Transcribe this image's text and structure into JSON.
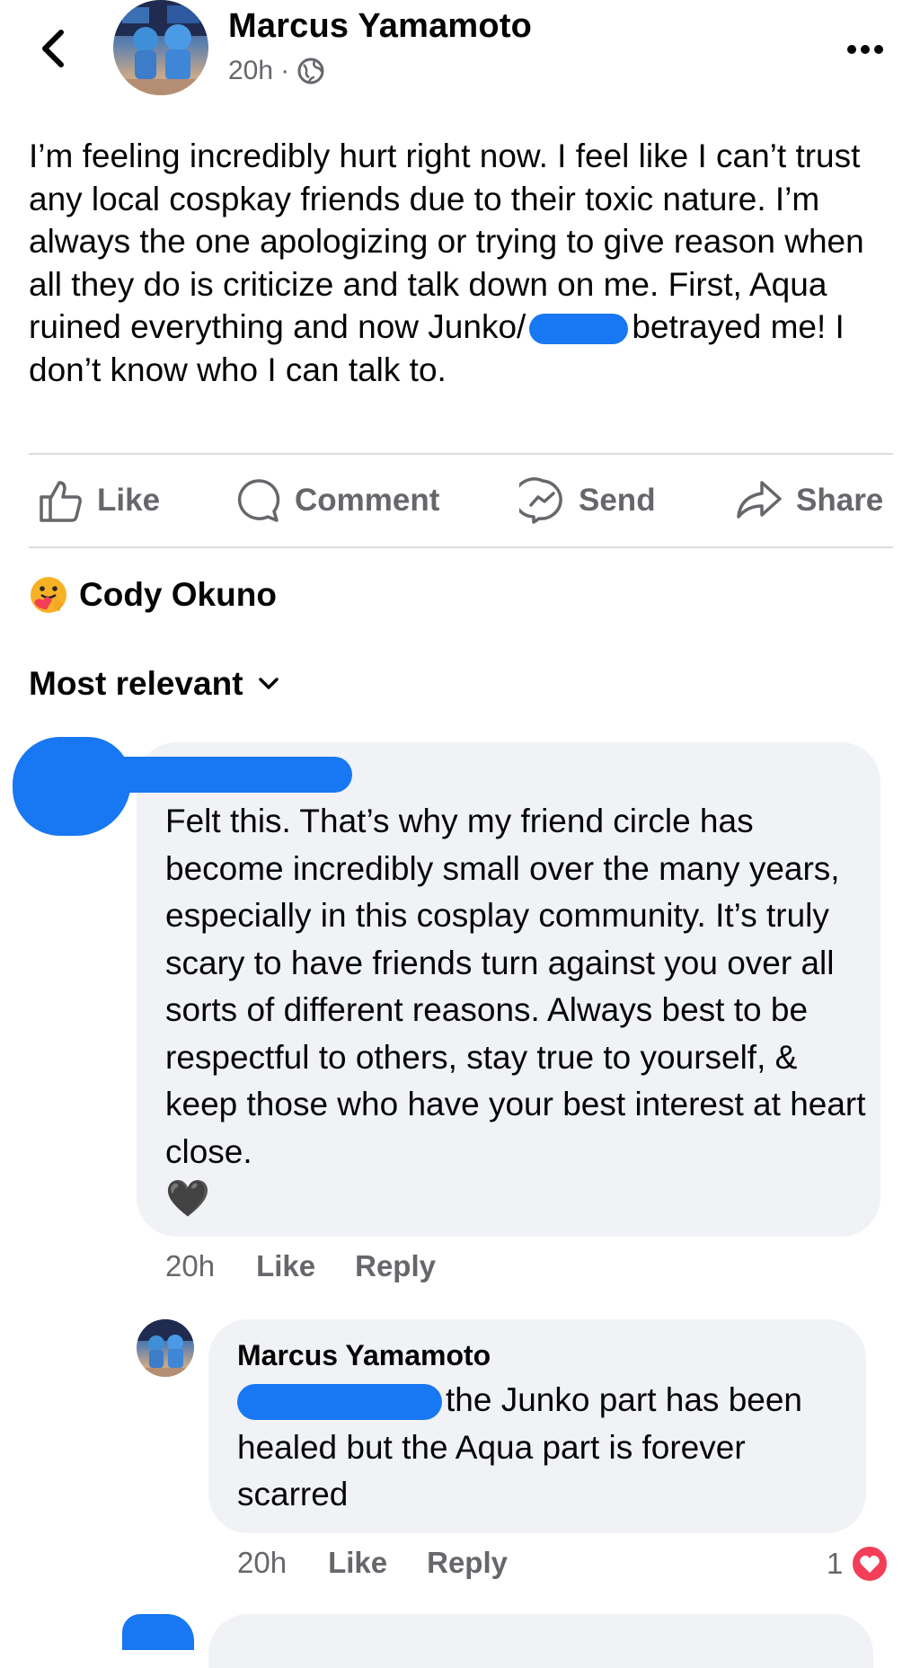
{
  "post": {
    "author": "Marcus Yamamoto",
    "time": "20h",
    "separator": "·",
    "audience_icon": "globe-icon",
    "text": "I’m feeling incredibly hurt right now. I feel like I can’t trust any local cospkay friends due to their toxic nature. I’m always the one apologizing or trying to give reason when all they do is criticize and talk down on me. First, Aqua ruined everything and now",
    "text_tail_before_redaction": "Junko/",
    "text_tail_after_redaction": "betrayed me! I don’t know who I can talk to."
  },
  "actions": {
    "like": "Like",
    "comment": "Comment",
    "send": "Send",
    "share": "Share"
  },
  "reactions": {
    "emoji": "care-reaction-icon",
    "reactor": "Cody Okuno"
  },
  "sort": {
    "label": "Most relevant"
  },
  "comments": [
    {
      "text": "Felt this. That’s why my friend circle has become incredibly small over the many years, especially in this cosplay community. It’s truly scary to have friends turn against you over all sorts of different reasons. Always best to be respectful to others, stay true to yourself, & keep those who have your best interest at heart close.",
      "emoji": "🖤",
      "time": "20h",
      "like": "Like",
      "reply": "Reply"
    },
    {
      "author": "Marcus Yamamoto",
      "text": "the Junko part has been healed but the Aqua part is forever scarred",
      "time": "20h",
      "like": "Like",
      "reply": "Reply",
      "reaction_count": "1"
    }
  ],
  "colors": {
    "text": "#050505",
    "secondary": "#65676b",
    "bubble": "#f0f2f5",
    "redaction": "#1877f2",
    "heart": "#f33e58"
  }
}
